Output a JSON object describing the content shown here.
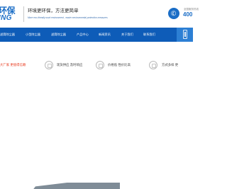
{
  "header": {
    "logo_cn": "环保",
    "logo_en": "ING",
    "slogan_cn": "环境更环保，方法更简单",
    "slogan_en": "More eco-friendly work environment , easier environmental protection measures",
    "hotline_label": "全国服务热线",
    "hotline_number": "400"
  },
  "nav": {
    "items": [
      {
        "label": "滤筒除尘器"
      },
      {
        "label": "小型除尘器"
      },
      {
        "label": "滤筒除尘器"
      },
      {
        "label": "产品中心"
      },
      {
        "label": "新闻资讯"
      },
      {
        "label": "关于我们"
      },
      {
        "label": "联系我们"
      }
    ]
  },
  "features": [
    {
      "label": "大厂家 更值得信赖",
      "color": "#e8391d"
    },
    {
      "label": "现货供应 及时响应"
    },
    {
      "label": "价格低 性价比高"
    },
    {
      "label": "方式多样 更"
    }
  ],
  "colors": {
    "brand_blue": "#1a6dc6",
    "nav_blue": "#0e5cb8",
    "accent_red": "#e8391d"
  }
}
